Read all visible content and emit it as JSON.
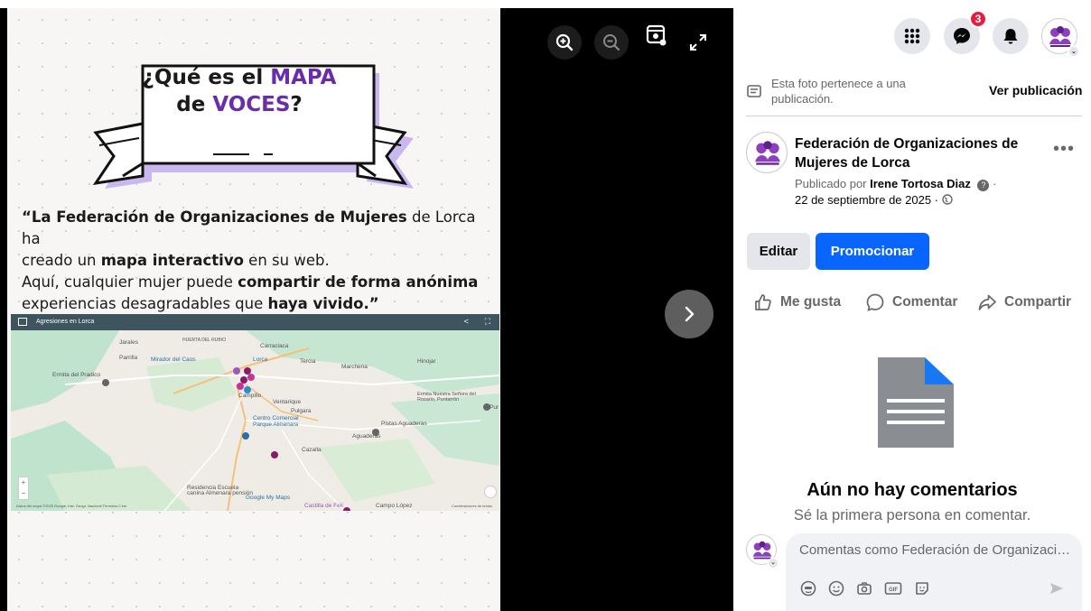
{
  "viewer": {
    "zoom_in_icon": "zoom-in-icon",
    "zoom_out_icon": "zoom-out-icon",
    "tag_icon": "tag-icon",
    "fullscreen_icon": "fullscreen-icon",
    "next_icon": "chevron-right-icon"
  },
  "photo": {
    "banner_line1_a": "¿Qué es el ",
    "banner_line1_b": "MAPA",
    "banner_line2_a": "de ",
    "banner_line2_b": "VOCES",
    "banner_line2_c": "?",
    "quote": {
      "p1_bold": "“La Federación de Organizaciones de Mujeres",
      "p1_rest": " de Lorca ha",
      "p2_a": "creado un ",
      "p2_bold": "mapa interactivo",
      "p2_rest": " en su web.",
      "p3_a": "Aquí, cualquier mujer puede ",
      "p3_bold": "compartir de forma anónima",
      "p4_a": "experiencias desagradables que ",
      "p4_bold": "haya vivido",
      "p4_end": ".”"
    },
    "map": {
      "title": "Agresiones en Lorca",
      "labels": {
        "jarales": "Jarales",
        "huerta": "HUERTA DEL RUBIO",
        "carraclaca": "Carraclaca",
        "parrilla": "Parrilla",
        "mirador": "Mirador del Caos",
        "lorca": "Lorca",
        "tercia": "Tercia",
        "marchena": "Marchena",
        "hinojar": "Hinojar",
        "ermita_pradico": "Ermita del Pradico",
        "campillo": "Campillo",
        "ventarique": "Ventarique",
        "pulgara": "Pulgara",
        "ermita_rosario": "Ermita Nuestra Señora del Rosario, Puntarrón",
        "centro": "Centro Comercial Parque Almenara",
        "pistas": "Pistas Aguaderas",
        "aguaderas": "Aguaderas",
        "cazalla": "Cazalla",
        "residencia": "Residencia Escuela canina Almenara pensión",
        "castilla": "Castilla de Felí",
        "campo_lopez": "Campo López",
        "pur": "Pur",
        "mymaps": "Google My Maps",
        "footer": "Datos del mapa ©2025 Google, Inst. Geogr. Nacional  Términos  2 km",
        "atajos": "Combinaciones de teclas"
      }
    }
  },
  "topnav": {
    "menu_icon": "grid-menu-icon",
    "messenger_icon": "messenger-icon",
    "messenger_badge": "3",
    "notifications_icon": "bell-icon",
    "profile_icon": "profile-avatar"
  },
  "post": {
    "notice": "Esta foto pertenece a una publicación.",
    "view_post": "Ver publicación",
    "page_name": "Federación de Organizaciones de Mujeres de Lorca",
    "published_by_label": "Publicado por ",
    "author": "Irene Tortosa Diaz",
    "date": "22 de septiembre de 2025 ·",
    "more_icon": "•••",
    "edit_label": "Editar",
    "promote_label": "Promocionar",
    "like_label": "Me gusta",
    "comment_label": "Comentar",
    "share_label": "Compartir"
  },
  "comments": {
    "empty_title": "Aún no hay comentarios",
    "empty_subtitle": "Sé la primera persona en comentar.",
    "placeholder": "Comentas como Federación de Organizaciones de Mujeres de Lorca",
    "icons": [
      "avatar-sticker-icon",
      "emoji-icon",
      "camera-icon",
      "gif-icon",
      "sticker-icon",
      "send-icon"
    ]
  },
  "colors": {
    "accent_blue": "#0866ff",
    "brand_purple": "#6a2ca8",
    "badge_red": "#e41e3f"
  }
}
